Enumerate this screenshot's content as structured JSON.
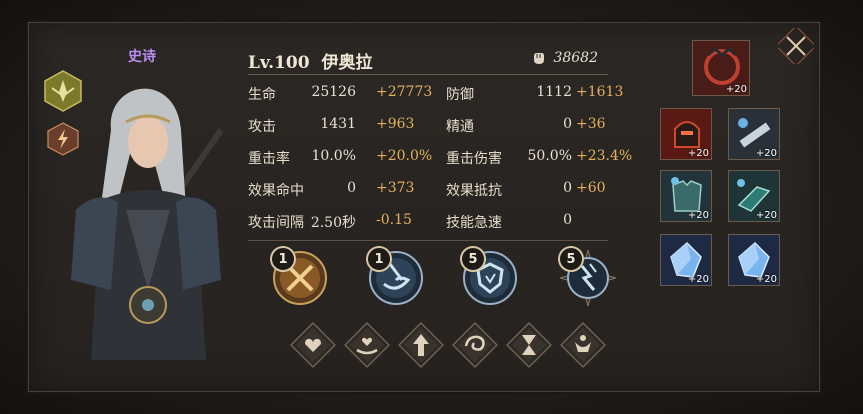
{
  "hero": {
    "rarity": "史诗",
    "level": "Lv.100",
    "name": "伊奥拉",
    "power": "38682"
  },
  "stats": [
    {
      "label": "生命",
      "base": "25126",
      "bonus": "+27773"
    },
    {
      "label": "防御",
      "base": "1112",
      "bonus": "+1613"
    },
    {
      "label": "攻击",
      "base": "1431",
      "bonus": "+963"
    },
    {
      "label": "精通",
      "base": "0",
      "bonus": "+36"
    },
    {
      "label": "重击率",
      "base": "10.0%",
      "bonus": "+20.0%"
    },
    {
      "label": "重击伤害",
      "base": "50.0%",
      "bonus": "+23.4%"
    },
    {
      "label": "效果命中",
      "base": "0",
      "bonus": "+373"
    },
    {
      "label": "效果抵抗",
      "base": "0",
      "bonus": "+60"
    },
    {
      "label": "攻击间隔",
      "base": "2.50秒",
      "bonus": "-0.15"
    },
    {
      "label": "技能急速",
      "base": "0",
      "bonus": ""
    }
  ],
  "skills": [
    {
      "level": "1",
      "icon": "crossed-swords-icon"
    },
    {
      "level": "1",
      "icon": "spiral-strike-icon"
    },
    {
      "level": "5",
      "icon": "shield-hand-icon"
    },
    {
      "level": "5",
      "icon": "lightning-claw-icon"
    }
  ],
  "runes": [
    {
      "icon": "heart-icon"
    },
    {
      "icon": "heart-hand-icon"
    },
    {
      "icon": "arrow-up-icon"
    },
    {
      "icon": "swirl-icon"
    },
    {
      "icon": "hourglass-icon"
    },
    {
      "icon": "crown-icon"
    }
  ],
  "equipment": [
    {
      "slot": "accessory",
      "level": "+20",
      "color": "#8b2a22"
    },
    {
      "slot": "helmet",
      "level": "+20",
      "color": "#7a2a20"
    },
    {
      "slot": "weapon",
      "level": "+20",
      "color": "#3d4e5c"
    },
    {
      "slot": "armor",
      "level": "+20",
      "color": "#2d4a44"
    },
    {
      "slot": "gloves",
      "level": "+20",
      "color": "#2a4a48"
    },
    {
      "slot": "gem-1",
      "level": "+20",
      "color": "#2a3a5a"
    },
    {
      "slot": "gem-2",
      "level": "+20",
      "color": "#2a3a5a"
    }
  ],
  "colors": {
    "rarity": "#b98cf0",
    "bonus": "#e3b25b",
    "accent_gold": "#c8a15a"
  }
}
